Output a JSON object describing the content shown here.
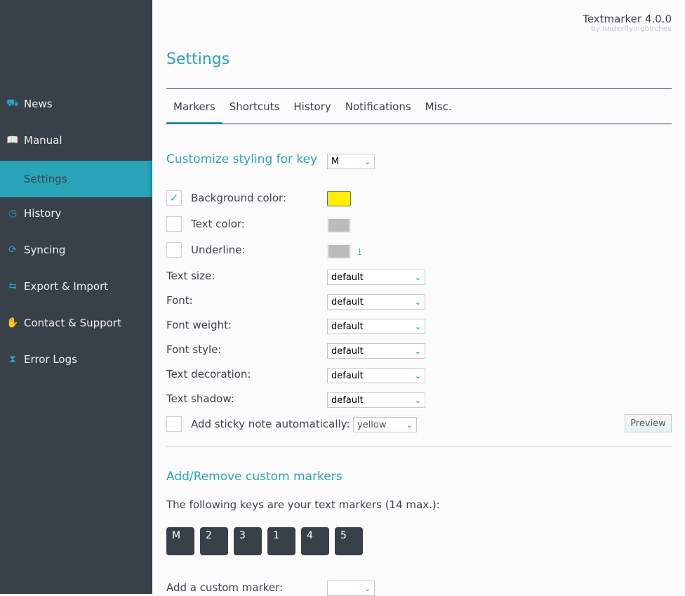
{
  "app": {
    "name": "Textmarker 4.0.0",
    "by": "by underflyingbirches"
  },
  "colors": {
    "sidebar": "#38404a",
    "accent": "#2aa4b8",
    "bg_swatch": "#ffee00",
    "inactive_swatch": "#bbbbbb"
  },
  "sidebar": {
    "items": [
      {
        "label": "News",
        "icon": "dolly-icon"
      },
      {
        "label": "Manual",
        "icon": "book-icon"
      },
      {
        "label": "Settings",
        "icon": "",
        "active": true
      },
      {
        "label": "History",
        "icon": "clock-icon"
      },
      {
        "label": "Syncing",
        "icon": "sync-icon"
      },
      {
        "label": "Export & Import",
        "icon": "exchange-icon"
      },
      {
        "label": "Contact & Support",
        "icon": "hand-icon"
      },
      {
        "label": "Error Logs",
        "icon": "dna-icon"
      }
    ]
  },
  "page": {
    "title": "Settings"
  },
  "tabs": [
    {
      "label": "Markers",
      "active": true
    },
    {
      "label": "Shortcuts"
    },
    {
      "label": "History"
    },
    {
      "label": "Notifications"
    },
    {
      "label": "Misc."
    }
  ],
  "styling": {
    "heading": "Customize styling for key",
    "key_value": "M",
    "background": {
      "label": "Background color:",
      "checked": true
    },
    "text_color": {
      "label": "Text color:",
      "checked": false
    },
    "underline": {
      "label": "Underline:",
      "checked": false,
      "info": "i"
    },
    "selects": [
      {
        "label": "Text size:",
        "value": "default"
      },
      {
        "label": "Font:",
        "value": "default"
      },
      {
        "label": "Font weight:",
        "value": "default"
      },
      {
        "label": "Font style:",
        "value": "default"
      },
      {
        "label": "Text decoration:",
        "value": "default"
      },
      {
        "label": "Text shadow:",
        "value": "default"
      }
    ],
    "sticky": {
      "label": "Add sticky note automatically:",
      "value": "yellow",
      "checked": false
    },
    "preview": "Preview"
  },
  "custom": {
    "heading": "Add/Remove custom markers",
    "info": "The following keys are your text markers (14 max.):",
    "keys": [
      "M",
      "2",
      "3",
      "1",
      "4",
      "5"
    ],
    "add_label": "Add a custom marker:"
  }
}
